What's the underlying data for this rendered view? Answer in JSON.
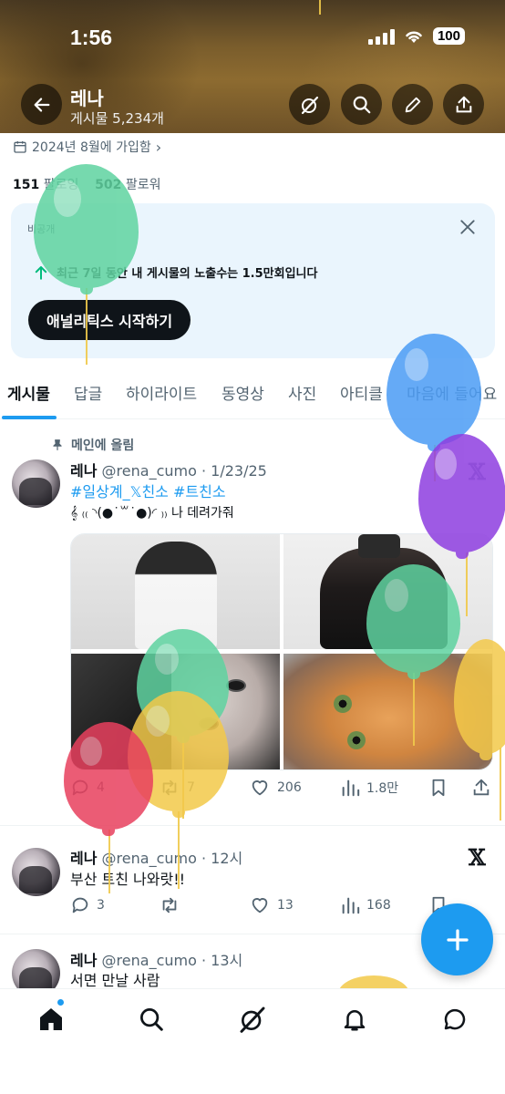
{
  "status_bar": {
    "time": "1:56",
    "battery": "100"
  },
  "header": {
    "name": "레나",
    "post_count": "게시물 5,234개"
  },
  "profile": {
    "joined": "2024년 8월에 가입함",
    "following_count": "151",
    "following_label": "팔로잉",
    "followers_count": "502",
    "followers_label": "팔로워"
  },
  "analytics": {
    "private_label": "비공개",
    "impressions_text": "최근 7일 동안 내 게시물의 노출수는 1.5만회입니다",
    "button_label": "애널리틱스 시작하기"
  },
  "tabs": [
    "게시물",
    "답글",
    "하이라이트",
    "동영상",
    "사진",
    "아티클",
    "마음에 들어요"
  ],
  "active_tab": "게시물",
  "posts": [
    {
      "pinned_label": "메인에 올림",
      "name": "레나",
      "meta": "@rena_cumo · 1/23/25",
      "hashtags": "#일상계_𝕏친소 #트친소",
      "text": "𝄞 ₍₍ ◝(●˙꒳˙●)◜ ₎₎ 나 데려가줘",
      "replies": "4",
      "reposts": "7",
      "likes": "206",
      "views": "1.8만"
    },
    {
      "name": "레나",
      "meta": "@rena_cumo · 12시",
      "text": "부산 트친 나와랏!!",
      "replies": "3",
      "reposts": "",
      "likes": "13",
      "views": "168"
    },
    {
      "name": "레나",
      "meta": "@rena_cumo · 13시",
      "text": "서면 만날 사람"
    }
  ],
  "icons": {
    "back": "arrow-left-icon",
    "grok": "grok-icon",
    "search": "search-icon",
    "edit": "pencil-icon",
    "share": "share-icon",
    "calendar": "calendar-icon",
    "close": "close-icon",
    "arrow_up": "arrow-up-icon",
    "pin": "pin-icon",
    "x_logo": "x-logo-icon"
  },
  "x_logo_glyph": "𝕏",
  "colors": {
    "accent": "#1d9bf0",
    "text": "#0f1419",
    "muted": "#536471",
    "analytics_bg": "#eaf5fd"
  }
}
